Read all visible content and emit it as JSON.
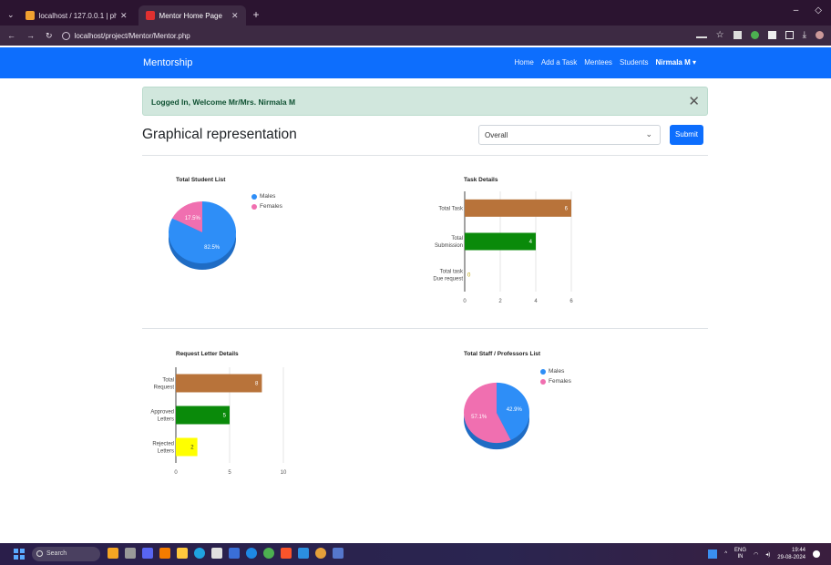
{
  "browser": {
    "tabs": [
      {
        "title": "localhost / 127.0.0.1 | phpMyA",
        "active": false
      },
      {
        "title": "Mentor Home Page",
        "active": true
      }
    ],
    "new_tab": "+",
    "url": "localhost/project/Mentor/Mentor.php"
  },
  "navbar": {
    "brand": "Mentorship",
    "links": [
      "Home",
      "Add a Task",
      "Mentees",
      "Students"
    ],
    "user": "Nirmala M ▾"
  },
  "alert": {
    "message": "Logged In, Welcome Mr/Mrs. Nirmala M",
    "close": "✕"
  },
  "page": {
    "title": "Graphical representation",
    "select_value": "Overall",
    "submit_label": "Submit"
  },
  "colors": {
    "primary": "#0d6efd",
    "blue": "#2e8ef7",
    "pink": "#f06fb0",
    "brown": "#b8733a",
    "green": "#0a8a0a",
    "yellow": "#ffff00"
  },
  "chart_data": [
    {
      "type": "pie",
      "title": "Total Student List",
      "labels": [
        "Males",
        "Females"
      ],
      "values": [
        82.5,
        17.5
      ],
      "data_labels": [
        "82.5%",
        "17.5%"
      ]
    },
    {
      "type": "bar",
      "orientation": "horizontal",
      "title": "Task Details",
      "categories": [
        "Total Task",
        "Total Submission",
        "Total task Due request"
      ],
      "values": [
        6,
        4,
        0
      ],
      "xlim": [
        0,
        6
      ],
      "ticks": [
        "0",
        "2",
        "4",
        "6"
      ]
    },
    {
      "type": "bar",
      "orientation": "horizontal",
      "title": "Request Letter Details",
      "categories": [
        "Total Request",
        "Approved Letters",
        "Rejected Letters"
      ],
      "values": [
        8,
        5,
        2
      ],
      "xlim": [
        0,
        10
      ],
      "ticks": [
        "0",
        "5",
        "10"
      ]
    },
    {
      "type": "pie",
      "title": "Total Staff / Professors List",
      "labels": [
        "Males",
        "Females"
      ],
      "values": [
        42.9,
        57.1
      ],
      "data_labels": [
        "42.9%",
        "57.1%"
      ]
    }
  ],
  "taskbar": {
    "search": "Search",
    "lang": "ENG\nIN",
    "time": "19:44",
    "date": "29-08-2024"
  }
}
